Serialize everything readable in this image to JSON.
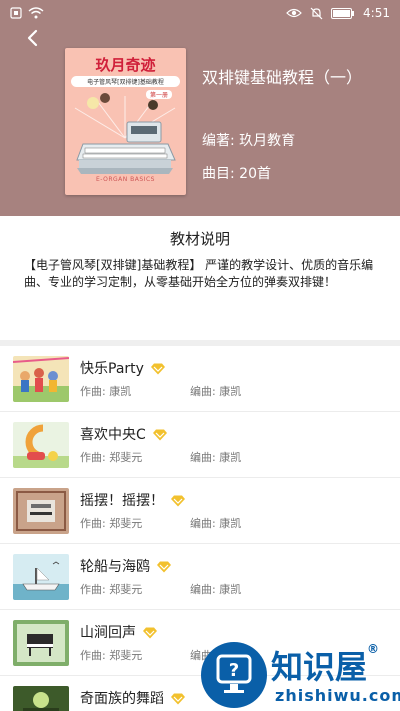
{
  "status_bar": {
    "time": "4:51"
  },
  "book": {
    "name": "双排键基础教程（一）",
    "author_line": "编著:   玖月教育",
    "count_line": "曲目:   20首",
    "cover": {
      "title": "玖月奇迹",
      "subtitle": "电子管风琴[双排键]基础教程",
      "volume": "第一册",
      "english": "E-ORGAN BASICS"
    }
  },
  "description": {
    "title": "教材说明",
    "text": "【电子管风琴[双排键]基础教程】 严谨的教学设计、优质的音乐编曲、专业的学习定制，从零基础开始全方位的弹奏双排键！"
  },
  "songs": [
    {
      "name": "快乐Party",
      "composer": "作曲:   康凯",
      "arranger": "编曲:   康凯"
    },
    {
      "name": "喜欢中央C",
      "composer": "作曲:   郑斐元",
      "arranger": "编曲:   康凯"
    },
    {
      "name": "摇摆！摇摆！",
      "composer": "作曲:   郑斐元",
      "arranger": "编曲:   康凯"
    },
    {
      "name": "轮船与海鸥",
      "composer": "作曲:   郑斐元",
      "arranger": "编曲:   康凯"
    },
    {
      "name": "山涧回声",
      "composer": "作曲:   郑斐元",
      "arranger": "编曲:   康凯"
    },
    {
      "name": "奇面族的舞蹈",
      "composer": "",
      "arranger": ""
    }
  ],
  "watermark": {
    "brand": "知识屋",
    "registered": "®",
    "url": "zhishiwu.com"
  },
  "colors": {
    "header_bg": "#a7827f",
    "vip_gold": "#f2c12e",
    "watermark_blue": "#0a5fa8"
  }
}
